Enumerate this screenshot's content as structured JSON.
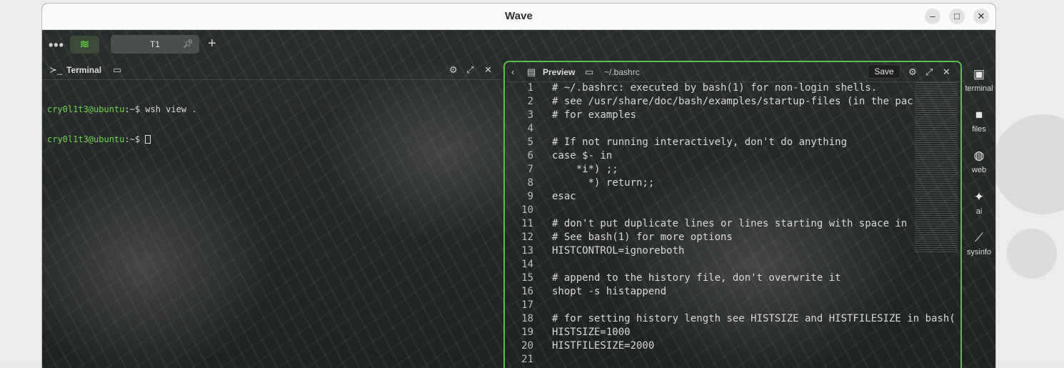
{
  "window": {
    "title": "Wave",
    "minimize_icon": "minimize-icon",
    "maximize_icon": "maximize-icon",
    "close_icon": "close-icon"
  },
  "tabbar": {
    "tabs": [
      {
        "label": "T1"
      }
    ],
    "add_tab_symbol": "+"
  },
  "terminal_pane": {
    "title": "Terminal",
    "lines": [
      {
        "prompt": "cry0l1t3@ubuntu",
        "path": ":~$",
        "command": " wsh view ."
      },
      {
        "prompt": "cry0l1t3@ubuntu",
        "path": ":~$",
        "command": " "
      }
    ]
  },
  "preview_pane": {
    "title": "Preview",
    "path": "~/.bashrc",
    "save_label": "Save",
    "code_lines": [
      {
        "n": "1",
        "text": "# ~/.bashrc: executed by bash(1) for non-login shells."
      },
      {
        "n": "2",
        "text": "# see /usr/share/doc/bash/examples/startup-files (in the pac"
      },
      {
        "n": "3",
        "text": "# for examples"
      },
      {
        "n": "4",
        "text": ""
      },
      {
        "n": "5",
        "text": "# If not running interactively, don't do anything"
      },
      {
        "n": "6",
        "text": "case $- in"
      },
      {
        "n": "7",
        "text": "    *i*) ;;"
      },
      {
        "n": "8",
        "text": "      *) return;;"
      },
      {
        "n": "9",
        "text": "esac"
      },
      {
        "n": "10",
        "text": ""
      },
      {
        "n": "11",
        "text": "# don't put duplicate lines or lines starting with space in"
      },
      {
        "n": "12",
        "text": "# See bash(1) for more options"
      },
      {
        "n": "13",
        "text": "HISTCONTROL=ignoreboth"
      },
      {
        "n": "14",
        "text": ""
      },
      {
        "n": "15",
        "text": "# append to the history file, don't overwrite it"
      },
      {
        "n": "16",
        "text": "shopt -s histappend"
      },
      {
        "n": "17",
        "text": ""
      },
      {
        "n": "18",
        "text": "# for setting history length see HISTSIZE and HISTFILESIZE in bash("
      },
      {
        "n": "19",
        "text": "HISTSIZE=1000"
      },
      {
        "n": "20",
        "text": "HISTFILESIZE=2000"
      },
      {
        "n": "21",
        "text": ""
      }
    ]
  },
  "sidebar": {
    "items": [
      {
        "label": "terminal",
        "icon": "terminal-icon"
      },
      {
        "label": "files",
        "icon": "folder-icon"
      },
      {
        "label": "web",
        "icon": "globe-icon"
      },
      {
        "label": "ai",
        "icon": "sparkle-icon"
      },
      {
        "label": "sysinfo",
        "icon": "chart-icon"
      }
    ]
  },
  "colors": {
    "accent": "#58c142",
    "prompt": "#6fd34f"
  }
}
